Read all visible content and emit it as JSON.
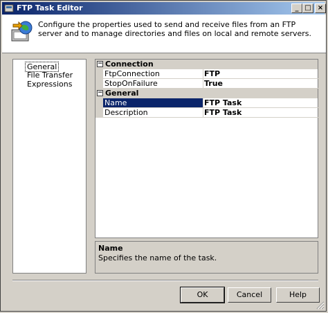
{
  "window": {
    "title": "FTP Task Editor"
  },
  "header": {
    "description": "Configure the properties used to send and receive files from an FTP server and to manage directories and files on local and remote servers.",
    "icon": "ftp-globe-icon"
  },
  "nav": {
    "items": [
      {
        "label": "General",
        "selected": true
      },
      {
        "label": "File Transfer"
      },
      {
        "label": "Expressions"
      }
    ]
  },
  "grid": {
    "categories": [
      {
        "label": "Connection",
        "rows": [
          {
            "name": "FtpConnection",
            "value": "FTP"
          },
          {
            "name": "StopOnFailure",
            "value": "True"
          }
        ]
      },
      {
        "label": "General",
        "rows": [
          {
            "name": "Name",
            "value": "FTP Task",
            "selected": true
          },
          {
            "name": "Description",
            "value": "FTP Task"
          }
        ]
      }
    ]
  },
  "help": {
    "title": "Name",
    "text": "Specifies the name of the task."
  },
  "buttons": {
    "ok": "OK",
    "cancel": "Cancel",
    "help": "Help"
  },
  "titlebar_buttons": {
    "minimize": "_",
    "maximize": "□",
    "close": "×"
  },
  "colors": {
    "selection": "#0a246a",
    "titlebar_start": "#0a246a",
    "face": "#d4d0c8"
  }
}
